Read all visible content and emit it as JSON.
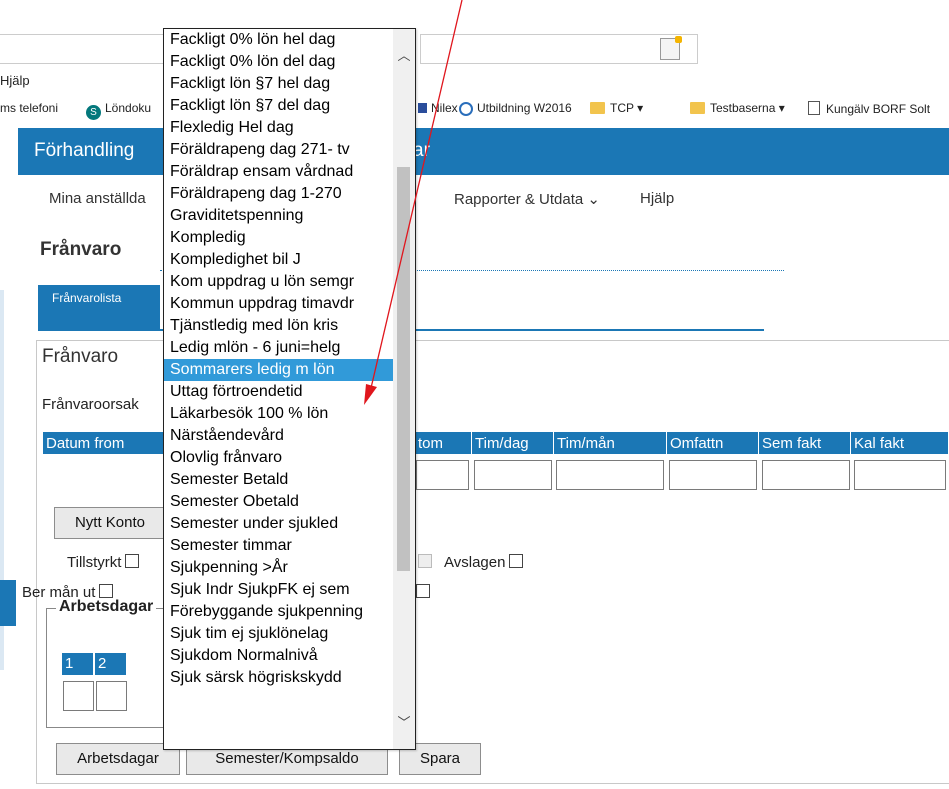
{
  "browser": {
    "menu_help": "Hjälp",
    "bookmarks": [
      {
        "label": "ms telefoni",
        "icon": "none"
      },
      {
        "label": "Löndoku",
        "icon": "sharepoint-icon"
      },
      {
        "label": "Nilex",
        "icon": "nilex-icon"
      },
      {
        "label": "Utbildning W2016",
        "icon": "ie-icon"
      },
      {
        "label": "TCP ▾",
        "icon": "folder-icon"
      },
      {
        "label": "Testbaserna ▾",
        "icon": "folder-icon"
      },
      {
        "label": "Kungälv BORF Solt",
        "icon": "page-icon"
      }
    ]
  },
  "app": {
    "title": "Förhandling",
    "title_right_fragment": "ar",
    "nav": [
      "Mina anställda",
      "Rapporter & Utdata ⌄",
      "Hjälp"
    ],
    "page_title": "Frånvaro",
    "tab_active": "Frånvarolista",
    "panel_title": "Frånvaro",
    "orsak_label": "Frånvaroorsak",
    "grid_headers": [
      "Datum from",
      "tom",
      "Tim/dag",
      "Tim/mån",
      "Omfattn",
      "Sem fakt",
      "Kal fakt"
    ],
    "btn_nytt_konto": "Nytt Konto",
    "tillstyrkt": "Tillstyrkt",
    "avslagen": "Avslagen",
    "ber_man_ut": "Ber mån ut",
    "arbetsdagar_legend": "Arbetsdagar",
    "day_headers": [
      "1",
      "2"
    ],
    "btn_arbetsdagar": "Arbetsdagar",
    "btn_semester": "Semester/Kompsaldo",
    "btn_spara": "Spara"
  },
  "dropdown": {
    "options": [
      "Fackligt 0% lön hel dag",
      "Fackligt 0% lön del dag",
      "Fackligt lön §7 hel dag",
      "Fackligt lön §7 del dag",
      "Flexledig Hel dag",
      "Föräldrapeng dag 271- tv",
      "Föräldrap ensam vårdnad",
      "Föräldrapeng dag 1-270",
      "Graviditetspenning",
      "Kompledig",
      "Kompledighet bil J",
      "Kom uppdrag u lön semgr",
      "Kommun uppdrag timavdr",
      "Tjänstledig med lön kris",
      "Ledig mlön - 6 juni=helg",
      "Sommarers ledig m lön",
      "Uttag förtroendetid",
      "Läkarbesök 100 % lön",
      "Närståendevård",
      "Olovlig frånvaro",
      "Semester Betald",
      "Semester Obetald",
      "Semester under sjukled",
      "Semester timmar",
      "Sjukpenning >År",
      "Sjuk Indr SjukpFK ej sem",
      "Förebyggande sjukpenning",
      "Sjuk tim ej sjuklönelag",
      "Sjukdom Normalnivå",
      "Sjuk särsk högriskskydd"
    ],
    "selected": "Sommarers ledig m lön",
    "scroll_up": "︿",
    "scroll_down": "﹀"
  },
  "annotation": {
    "arrow_color": "#e0161d"
  }
}
